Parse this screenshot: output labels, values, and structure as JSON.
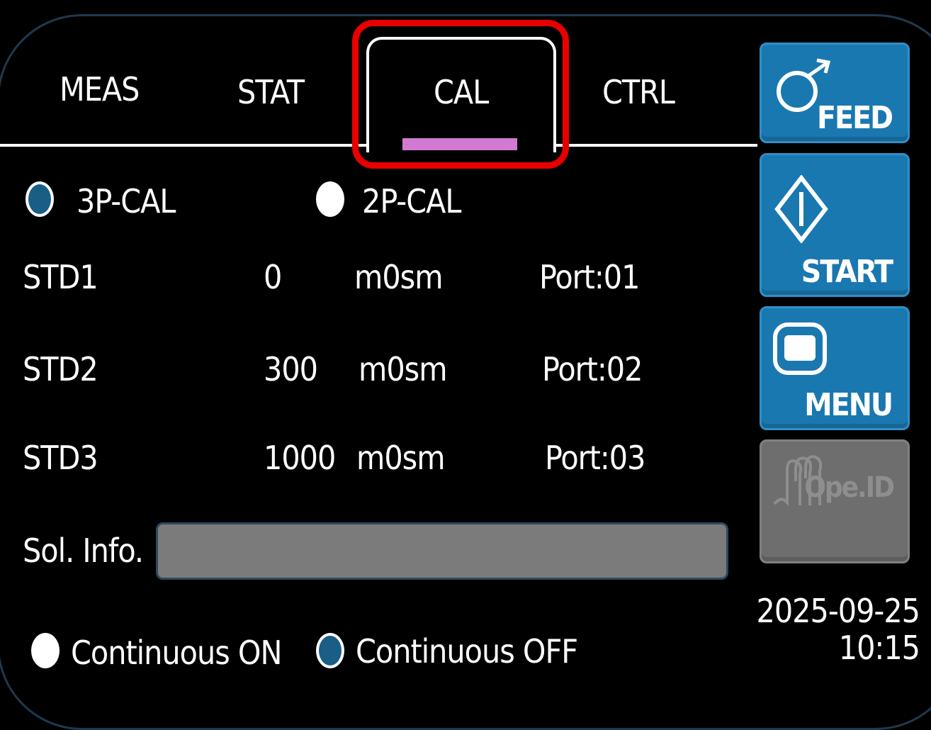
{
  "tabs": [
    {
      "label": "MEAS"
    },
    {
      "label": "STAT"
    },
    {
      "label": "CAL",
      "active": true
    },
    {
      "label": "CTRL"
    }
  ],
  "cal_mode": {
    "options": [
      {
        "label": "3P-CAL",
        "selected": true
      },
      {
        "label": "2P-CAL",
        "selected": false
      }
    ]
  },
  "standards": [
    {
      "name": "STD1",
      "value": "0",
      "unit": "m0sm",
      "port": "Port:01"
    },
    {
      "name": "STD2",
      "value": "300",
      "unit": "m0sm",
      "port": "Port:02"
    },
    {
      "name": "STD3",
      "value": "1000",
      "unit": "m0sm",
      "port": "Port:03"
    }
  ],
  "sol_info": {
    "label": "Sol. Info.",
    "value": ""
  },
  "continuous": {
    "options": [
      {
        "label": "Continuous ON",
        "selected": false
      },
      {
        "label": "Continuous OFF",
        "selected": true
      }
    ]
  },
  "side_buttons": [
    {
      "label": "FEED",
      "icon": "feed-icon",
      "enabled": true
    },
    {
      "label": "START",
      "icon": "start-icon",
      "enabled": true
    },
    {
      "label": "MENU",
      "icon": "menu-icon",
      "enabled": true
    },
    {
      "label": "Ope.ID",
      "icon": "operator-id-icon",
      "enabled": false
    }
  ],
  "datetime": {
    "date": "2025-09-25",
    "time": "10:15"
  },
  "colors": {
    "background": "#000000",
    "button_blue": "#1a78b0",
    "button_disabled": "#6e6e6e",
    "tab_indicator": "#d27ad2",
    "highlight": "#e80000",
    "radio_selected": "#1a5e86"
  }
}
